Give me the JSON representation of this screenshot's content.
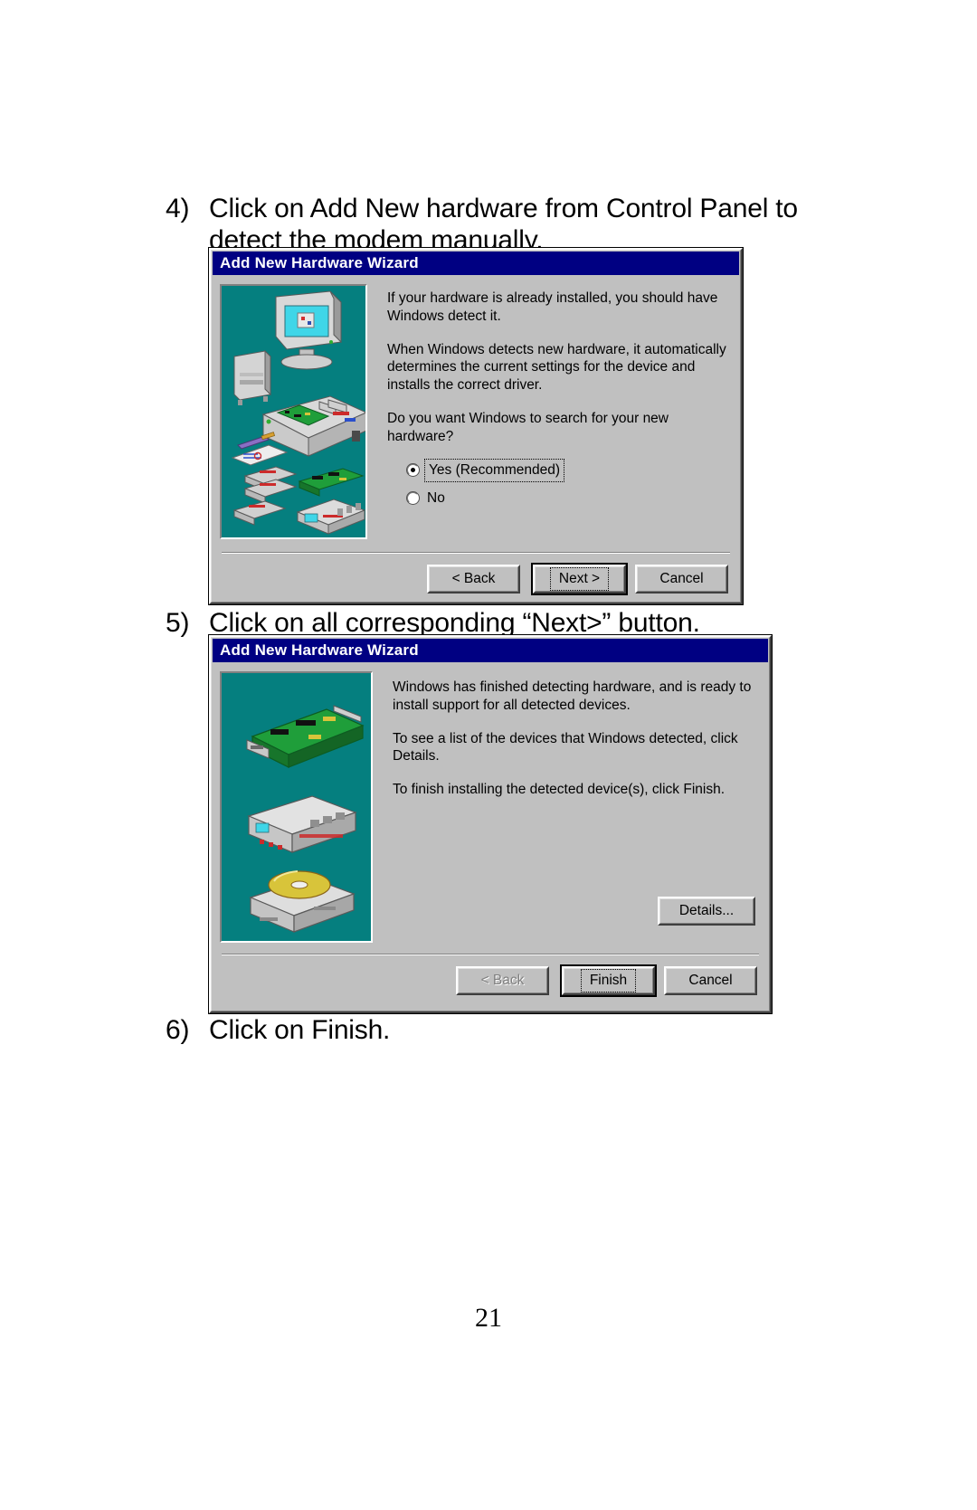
{
  "document": {
    "page_number": "21",
    "steps": [
      {
        "number": "4)",
        "text": "Click on Add New hardware from Control Panel to detect the modem manually."
      },
      {
        "number": "5)",
        "text": "Click on all corresponding “Next>” button."
      },
      {
        "number": "6)",
        "text": "Click on Finish."
      }
    ]
  },
  "colors": {
    "titlebar": "#000082",
    "dialog_face": "#c0c0c0",
    "illustration_bg": "#057f7f"
  },
  "dialog1": {
    "title": "Add New Hardware Wizard",
    "paragraphs": [
      "If your hardware is already installed, you should have Windows detect it.",
      "When Windows detects new hardware, it automatically determines the current settings for the device and installs the correct driver.",
      "Do you want Windows to search for your new hardware?"
    ],
    "options": [
      {
        "label": "Yes (Recommended)",
        "accel": "Y",
        "selected": true,
        "focused": true
      },
      {
        "label": "No",
        "accel": "N",
        "selected": false,
        "focused": false
      }
    ],
    "buttons": [
      {
        "label": "< Back",
        "accel": "B",
        "default": false,
        "disabled": false
      },
      {
        "label": "Next >",
        "accel": "N",
        "default": true,
        "disabled": false
      },
      {
        "label": "Cancel",
        "accel": "",
        "default": false,
        "disabled": false
      }
    ],
    "illustration": "computer-hardware-illustration"
  },
  "dialog2": {
    "title": "Add New Hardware Wizard",
    "paragraphs": [
      "Windows has finished detecting hardware, and is ready to install support for all detected devices.",
      "To see a list of the devices that Windows detected, click Details.",
      "To finish installing the detected device(s), click Finish."
    ],
    "details_button": {
      "label": "Details...",
      "accel": "D"
    },
    "buttons": [
      {
        "label": "< Back",
        "accel": "B",
        "default": false,
        "disabled": true
      },
      {
        "label": "Finish",
        "accel": "",
        "default": true,
        "disabled": false
      },
      {
        "label": "Cancel",
        "accel": "",
        "default": false,
        "disabled": false
      }
    ],
    "illustration": "detected-devices-illustration"
  }
}
